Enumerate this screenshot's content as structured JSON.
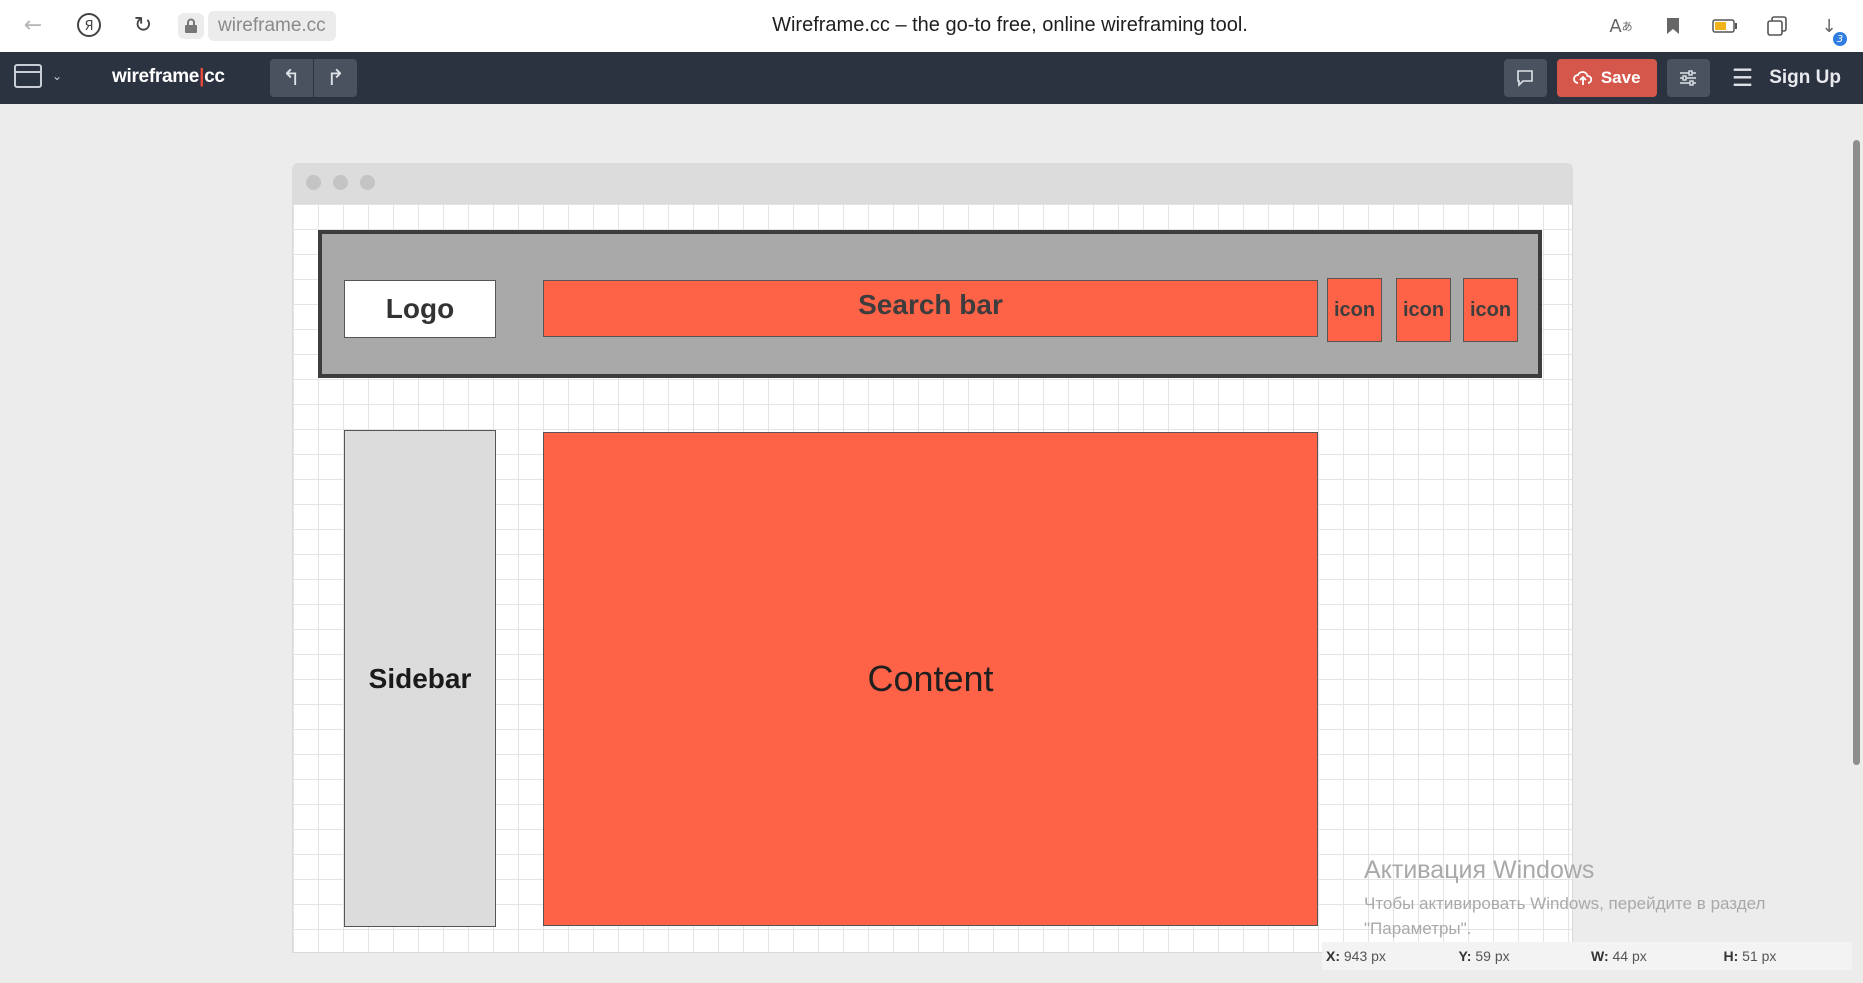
{
  "browser": {
    "address": "wireframe.cc",
    "page_title": "Wireframe.cc – the go-to free, online wireframing tool.",
    "downloads_badge": "3",
    "icons": [
      "back-arrow-icon",
      "yandex-icon",
      "reload-icon",
      "lock-icon",
      "translate-icon",
      "bookmark-icon",
      "battery-icon",
      "collections-icon",
      "downloads-icon"
    ]
  },
  "toolbar": {
    "brand_main": "wireframe",
    "brand_sep": "|",
    "brand_suffix": "cc",
    "save_label": "Save",
    "signup_label": "Sign Up",
    "accent_color": "#d5574b",
    "bg_color": "#2b3240"
  },
  "wireframe": {
    "logo": "Logo",
    "search": "Search bar",
    "icons": [
      "icon",
      "icon",
      "icon"
    ],
    "sidebar": "Sidebar",
    "content": "Content",
    "shape_color": "#ff6347"
  },
  "activation": {
    "title": "Активация Windows",
    "body": "Чтобы активировать Windows, перейдите в раздел \"Параметры\"."
  },
  "status": {
    "x_label": "X:",
    "x_value": "943 px",
    "y_label": "Y:",
    "y_value": "59 px",
    "w_label": "W:",
    "w_value": "44 px",
    "h_label": "H:",
    "h_value": "51 px"
  }
}
